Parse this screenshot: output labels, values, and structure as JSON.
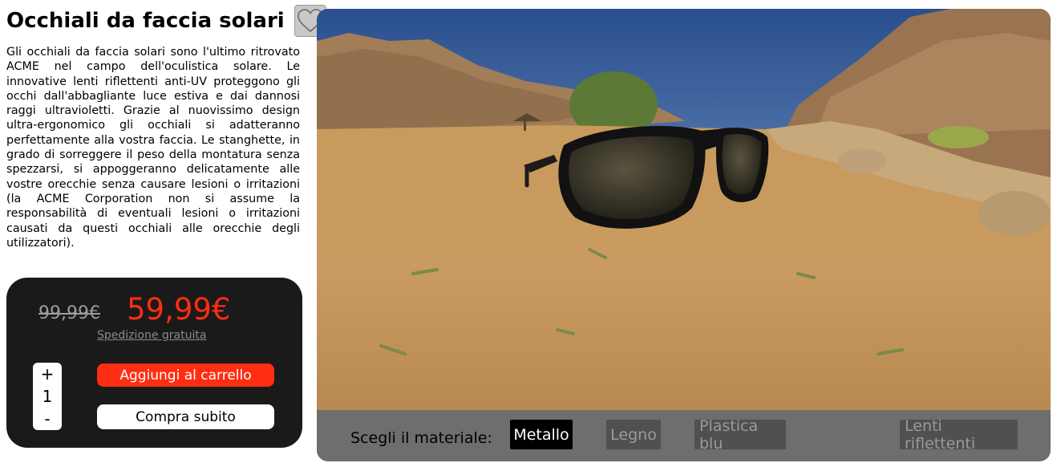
{
  "product": {
    "title": "Occhiali da faccia solari",
    "favorite_icon": "heart-icon",
    "description": "Gli occhiali da faccia solari sono l'ultimo ritrovato ACME nel campo dell'oculistica solare. Le innovative lenti riflettenti anti-UV proteggono gli occhi dall'abbagliante luce estiva e dai dannosi raggi ultravioletti. Grazie al nuovissimo design ultra-ergonomico gli occhiali si adatteranno perfettamente alla vostra faccia. Le stanghette, in grado di sorreggere il peso della montatura senza spezzarsi, si appoggeranno delicatamente alle vostre orecchie senza causare lesioni o irritazioni (la ACME Corporation non si assume la responsabilità di eventuali lesioni o irritazioni causati da questi occhiali alle orecchie degli utilizzatori)."
  },
  "pricing": {
    "old_price": "99,99€",
    "new_price": "59,99€",
    "shipping": "Spedizione gratuita",
    "qty_plus": "+",
    "qty_value": "1",
    "qty_minus": "-",
    "add_to_cart": "Aggiungi al carrello",
    "buy_now": "Compra subito"
  },
  "viewer": {
    "material_label": "Scegli il materiale:",
    "materials": [
      {
        "label": "Metallo",
        "selected": true
      },
      {
        "label": "Legno",
        "selected": false
      },
      {
        "label": "Plastica blu",
        "selected": false
      }
    ],
    "lens_option": "Lenti riflettenti"
  },
  "colors": {
    "accent": "#ff2d12",
    "price_box_bg": "#1a1a1a",
    "material_bar_bg": "#6e6e6e"
  }
}
